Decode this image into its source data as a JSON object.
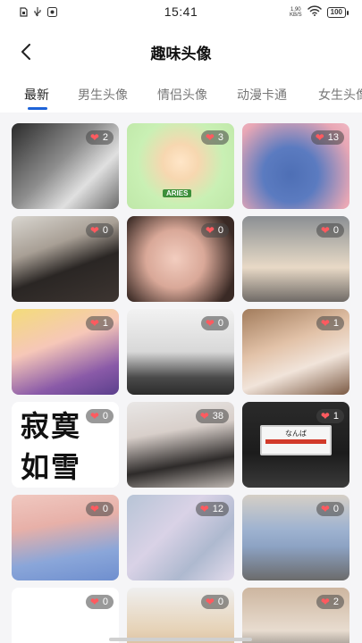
{
  "status_bar": {
    "time": "15:41",
    "net_speed_value": "1.90",
    "net_speed_unit": "KB/S",
    "battery": "100"
  },
  "header": {
    "title": "趣味头像"
  },
  "tabs": [
    {
      "label": "最新",
      "active": true
    },
    {
      "label": "男生头像",
      "active": false
    },
    {
      "label": "情侣头像",
      "active": false
    },
    {
      "label": "动漫卡通",
      "active": false
    },
    {
      "label": "女生头像",
      "active": false
    }
  ],
  "grid": {
    "items": [
      {
        "likes": "2"
      },
      {
        "likes": "3",
        "badge_text": "ARIES"
      },
      {
        "likes": "13"
      },
      {
        "likes": "0"
      },
      {
        "likes": "0"
      },
      {
        "likes": "0"
      },
      {
        "likes": "1"
      },
      {
        "likes": "0"
      },
      {
        "likes": "1"
      },
      {
        "likes": "0",
        "text_line1": "寂寞",
        "text_line2": "如雪"
      },
      {
        "likes": "38"
      },
      {
        "likes": "1",
        "sign_text": "なんば"
      },
      {
        "likes": "0"
      },
      {
        "likes": "12"
      },
      {
        "likes": "0"
      },
      {
        "likes": "0"
      },
      {
        "likes": "0"
      },
      {
        "likes": "2"
      }
    ]
  },
  "colors": {
    "accent": "#1e63d8",
    "heart": "#ff5a5f"
  }
}
